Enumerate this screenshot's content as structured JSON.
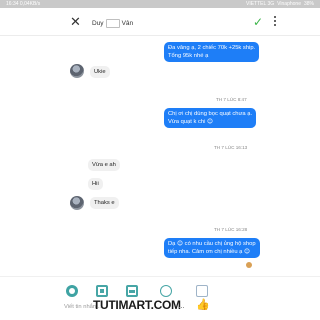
{
  "status_bar": {
    "time": "16:34",
    "left_info": "0,04KB/s",
    "carrier": "VIETTEL 3G",
    "extra": "Vinaphone",
    "battery": "38%"
  },
  "header": {
    "close_icon": "close-icon",
    "contact_name_prefix": "Duy",
    "contact_name_suffix": "Vân",
    "check_icon": "check-icon",
    "more_icon": "more-vertical-icon"
  },
  "messages": [
    {
      "side": "right",
      "lines": [
        "Đa vâng ạ, 2 chiếc 70k +25k ship.",
        "Tổng 95k nhé ạ"
      ]
    },
    {
      "side": "left",
      "avatar": true,
      "lines": [
        "Ukie"
      ]
    },
    {
      "side": "timestamp",
      "text": "TH 7 LÚC 8:47"
    },
    {
      "side": "right",
      "lines": [
        "Chị ơi chị dùng bọc quạt chưa ạ.",
        "Vừa quạt k chi 😊"
      ]
    },
    {
      "side": "timestamp",
      "text": "TH 7 LÚC 16:13"
    },
    {
      "side": "left",
      "lines": [
        "Vừa e ah"
      ]
    },
    {
      "side": "left",
      "lines": [
        "Hii"
      ]
    },
    {
      "side": "left",
      "avatar": true,
      "lines": [
        "Thaks e"
      ]
    },
    {
      "side": "timestamp",
      "text": "TH 7 LÚC 16:28"
    },
    {
      "side": "right",
      "lines": [
        "Dạ 😊 có nhu cầu chị ủng hộ shop",
        "tiếp nha. Cảm ơn chị nhiều ạ 😊"
      ]
    }
  ],
  "composer": {
    "placeholder": "Viết tin nhắn...",
    "watermark": "TUTIMART.COM",
    "ellipsis": "···",
    "like_icon": "like-icon"
  },
  "colors": {
    "outgoing_bubble": "#1e7ef7",
    "incoming_bubble": "#f0f0f0",
    "check": "#3db54a",
    "tool_icons": "#47a6a6"
  }
}
